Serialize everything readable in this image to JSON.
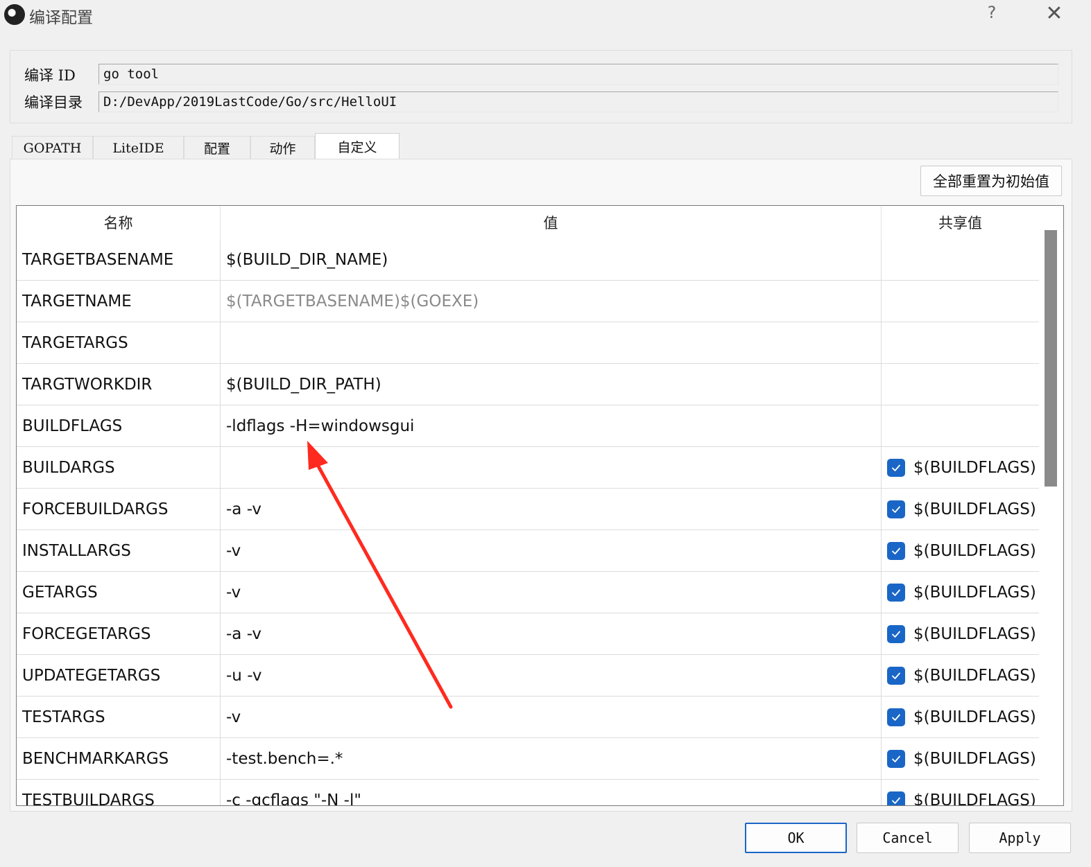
{
  "window": {
    "title": "编译配置",
    "help": "?",
    "close": "✕"
  },
  "header": {
    "id_label": "编译 ID",
    "id_value": "go tool",
    "dir_label": "编译目录",
    "dir_value": "D:/DevApp/2019LastCode/Go/src/HelloUI"
  },
  "tabs": [
    "GOPATH",
    "LiteIDE",
    "配置",
    "动作",
    "自定义"
  ],
  "active_tab": "自定义",
  "reset_button": "全部重置为初始值",
  "table": {
    "columns": [
      "名称",
      "值",
      "共享值"
    ],
    "rows": [
      {
        "name": "TARGETBASENAME",
        "value": "$(BUILD_DIR_NAME)",
        "value_muted": false,
        "shared_checked": false,
        "shared": ""
      },
      {
        "name": "TARGETNAME",
        "value": "$(TARGETBASENAME)$(GOEXE)",
        "value_muted": true,
        "shared_checked": false,
        "shared": ""
      },
      {
        "name": "TARGETARGS",
        "value": "",
        "value_muted": false,
        "shared_checked": false,
        "shared": ""
      },
      {
        "name": "TARGTWORKDIR",
        "value": "$(BUILD_DIR_PATH)",
        "value_muted": false,
        "shared_checked": false,
        "shared": ""
      },
      {
        "name": "BUILDFLAGS",
        "value": "-ldflags -H=windowsgui",
        "value_muted": false,
        "shared_checked": false,
        "shared": ""
      },
      {
        "name": "BUILDARGS",
        "value": "",
        "value_muted": false,
        "shared_checked": true,
        "shared": "$(BUILDFLAGS)"
      },
      {
        "name": "FORCEBUILDARGS",
        "value": "-a -v",
        "value_muted": false,
        "shared_checked": true,
        "shared": "$(BUILDFLAGS)"
      },
      {
        "name": "INSTALLARGS",
        "value": "-v",
        "value_muted": false,
        "shared_checked": true,
        "shared": "$(BUILDFLAGS)"
      },
      {
        "name": "GETARGS",
        "value": "-v",
        "value_muted": false,
        "shared_checked": true,
        "shared": "$(BUILDFLAGS)"
      },
      {
        "name": "FORCEGETARGS",
        "value": "-a -v",
        "value_muted": false,
        "shared_checked": true,
        "shared": "$(BUILDFLAGS)"
      },
      {
        "name": "UPDATEGETARGS",
        "value": "-u -v",
        "value_muted": false,
        "shared_checked": true,
        "shared": "$(BUILDFLAGS)"
      },
      {
        "name": "TESTARGS",
        "value": "-v",
        "value_muted": false,
        "shared_checked": true,
        "shared": "$(BUILDFLAGS)"
      },
      {
        "name": "BENCHMARKARGS",
        "value": "-test.bench=.*",
        "value_muted": false,
        "shared_checked": true,
        "shared": "$(BUILDFLAGS)"
      },
      {
        "name": "TESTBUILDARGS",
        "value": "-c -gcflags \"-N -l\"",
        "value_muted": false,
        "shared_checked": true,
        "shared": "$(BUILDFLAGS)"
      }
    ]
  },
  "buttons": {
    "ok": "OK",
    "cancel": "Cancel",
    "apply": "Apply"
  },
  "colors": {
    "checkbox": "#1a66c7",
    "annotation_arrow": "#ff2a1f"
  }
}
